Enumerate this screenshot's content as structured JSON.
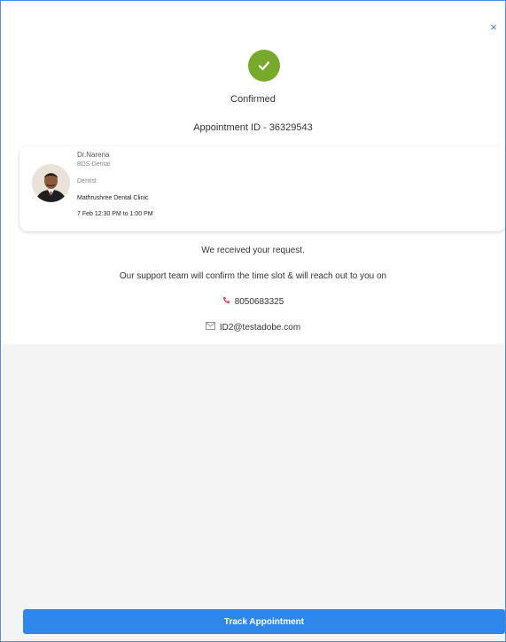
{
  "header": {
    "close_label": "×"
  },
  "status": {
    "label": "Confirmed",
    "appointment_id": "Appointment ID - 36329543"
  },
  "doctor": {
    "name": "Dr.Narena",
    "degree": "BDS-Dental",
    "specialty": "Dentist",
    "clinic": "Mathrushree Dental Clinic",
    "slot": "7 Feb 12:30 PM to 1:00 PM"
  },
  "messages": {
    "received": "We received your request.",
    "followup": "Our support team will confirm the time slot & will reach out to you on"
  },
  "contact": {
    "phone": "8050683325",
    "email": "ID2@testadobe.com"
  },
  "actions": {
    "track_label": "Track Appointment"
  },
  "colors": {
    "accent": "#2f87eb",
    "success": "#77a92a",
    "phone_icon": "#e0505a",
    "email_icon": "#8a95a5"
  },
  "icons": {
    "status": "check-icon",
    "phone": "phone-icon",
    "email": "mail-icon",
    "close": "close-icon"
  }
}
